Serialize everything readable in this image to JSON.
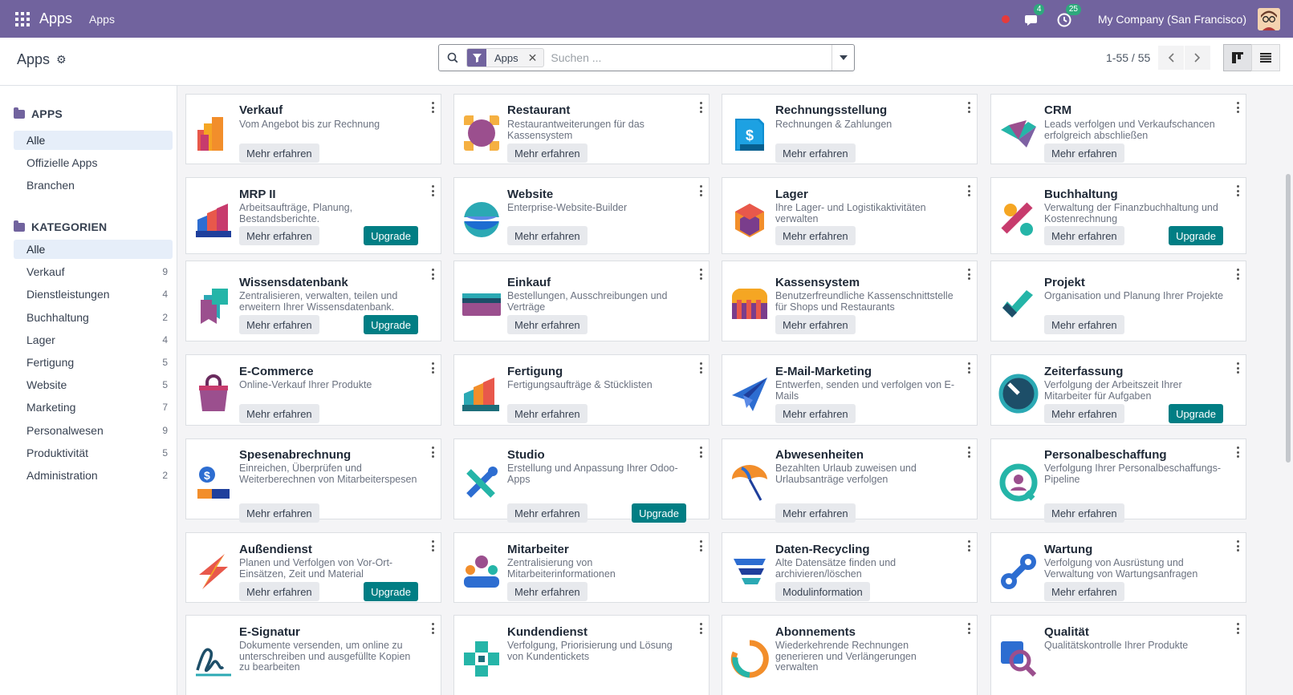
{
  "colors": {
    "navbar": "#71639e",
    "upgrade": "#017e84",
    "active_item": "#e6eef9"
  },
  "navbar": {
    "menu_icon": "apps-grid-icon",
    "title": "Apps",
    "menu_item": "Apps",
    "messages_badge": "4",
    "activity_badge": "25",
    "company": "My Company (San Francisco)"
  },
  "control": {
    "title": "Apps",
    "search": {
      "facet_label": "Apps",
      "placeholder": "Suchen ..."
    },
    "pager": "1-55 / 55"
  },
  "sidebar": {
    "apps_heading": "APPS",
    "apps_items": [
      {
        "label": "Alle",
        "active": true
      },
      {
        "label": "Offizielle Apps"
      },
      {
        "label": "Branchen"
      }
    ],
    "categories_heading": "KATEGORIEN",
    "category_items": [
      {
        "label": "Alle",
        "count": "",
        "active": true
      },
      {
        "label": "Verkauf",
        "count": "9"
      },
      {
        "label": "Dienstleistungen",
        "count": "4"
      },
      {
        "label": "Buchhaltung",
        "count": "2"
      },
      {
        "label": "Lager",
        "count": "4"
      },
      {
        "label": "Fertigung",
        "count": "5"
      },
      {
        "label": "Website",
        "count": "5"
      },
      {
        "label": "Marketing",
        "count": "7"
      },
      {
        "label": "Personalwesen",
        "count": "9"
      },
      {
        "label": "Produktivität",
        "count": "5"
      },
      {
        "label": "Administration",
        "count": "2"
      }
    ]
  },
  "apps": [
    {
      "name": "Verkauf",
      "desc": "Vom Angebot bis zur Rechnung",
      "button": "Mehr erfahren",
      "upgrade": "",
      "icon": "sales-icon"
    },
    {
      "name": "Restaurant",
      "desc": "Restaurantweiterungen für das Kassensystem",
      "button": "Mehr erfahren",
      "upgrade": "",
      "icon": "restaurant-icon"
    },
    {
      "name": "Rechnungsstellung",
      "desc": "Rechnungen & Zahlungen",
      "button": "Mehr erfahren",
      "upgrade": "",
      "icon": "invoicing-icon"
    },
    {
      "name": "CRM",
      "desc": "Leads verfolgen und Verkaufschancen erfolgreich abschließen",
      "button": "Mehr erfahren",
      "upgrade": "",
      "icon": "crm-icon"
    },
    {
      "name": "MRP II",
      "desc": "Arbeitsaufträge, Planung, Bestandsberichte.",
      "button": "Mehr erfahren",
      "upgrade": "Upgrade",
      "icon": "mrp-icon"
    },
    {
      "name": "Website",
      "desc": "Enterprise-Website-Builder",
      "button": "Mehr erfahren",
      "upgrade": "",
      "icon": "website-icon"
    },
    {
      "name": "Lager",
      "desc": "Ihre Lager- und Logistikaktivitäten verwalten",
      "button": "Mehr erfahren",
      "upgrade": "",
      "icon": "inventory-icon"
    },
    {
      "name": "Buchhaltung",
      "desc": "Verwaltung der Finanzbuchhaltung und Kostenrechnung",
      "button": "Mehr erfahren",
      "upgrade": "Upgrade",
      "icon": "accounting-icon"
    },
    {
      "name": "Wissensdatenbank",
      "desc": "Zentralisieren, verwalten, teilen und erweitern Ihrer Wissensdatenbank.",
      "button": "Mehr erfahren",
      "upgrade": "Upgrade",
      "icon": "knowledge-icon"
    },
    {
      "name": "Einkauf",
      "desc": "Bestellungen, Ausschreibungen und Verträge",
      "button": "Mehr erfahren",
      "upgrade": "",
      "icon": "purchase-icon"
    },
    {
      "name": "Kassensystem",
      "desc": "Benutzerfreundliche Kassenschnittstelle für Shops und Restaurants",
      "button": "Mehr erfahren",
      "upgrade": "",
      "icon": "pos-icon"
    },
    {
      "name": "Projekt",
      "desc": "Organisation und Planung Ihrer Projekte",
      "button": "Mehr erfahren",
      "upgrade": "",
      "icon": "project-icon"
    },
    {
      "name": "E-Commerce",
      "desc": "Online-Verkauf Ihrer Produkte",
      "button": "Mehr erfahren",
      "upgrade": "",
      "icon": "ecommerce-icon"
    },
    {
      "name": "Fertigung",
      "desc": "Fertigungsaufträge & Stücklisten",
      "button": "Mehr erfahren",
      "upgrade": "",
      "icon": "manufacturing-icon"
    },
    {
      "name": "E-Mail-Marketing",
      "desc": "Entwerfen, senden und verfolgen von E-Mails",
      "button": "Mehr erfahren",
      "upgrade": "",
      "icon": "email-marketing-icon"
    },
    {
      "name": "Zeiterfassung",
      "desc": "Verfolgung der Arbeitszeit Ihrer Mitarbeiter für Aufgaben",
      "button": "Mehr erfahren",
      "upgrade": "Upgrade",
      "icon": "timesheet-icon"
    },
    {
      "name": "Spesenabrechnung",
      "desc": "Einreichen, Überprüfen und Weiterberechnen von Mitarbeiterspesen",
      "button": "Mehr erfahren",
      "upgrade": "",
      "icon": "expenses-icon"
    },
    {
      "name": "Studio",
      "desc": "Erstellung und Anpassung Ihrer Odoo-Apps",
      "button": "Mehr erfahren",
      "upgrade": "Upgrade",
      "icon": "studio-icon"
    },
    {
      "name": "Abwesenheiten",
      "desc": "Bezahlten Urlaub zuweisen und Urlaubsanträge verfolgen",
      "button": "Mehr erfahren",
      "upgrade": "",
      "icon": "time-off-icon"
    },
    {
      "name": "Personalbeschaffung",
      "desc": "Verfolgung Ihrer Personalbeschaffungs-Pipeline",
      "button": "Mehr erfahren",
      "upgrade": "",
      "icon": "recruitment-icon"
    },
    {
      "name": "Außendienst",
      "desc": "Planen und Verfolgen von Vor-Ort-Einsätzen, Zeit und Material",
      "button": "Mehr erfahren",
      "upgrade": "Upgrade",
      "icon": "field-service-icon"
    },
    {
      "name": "Mitarbeiter",
      "desc": "Zentralisierung von Mitarbeiterinformationen",
      "button": "Mehr erfahren",
      "upgrade": "",
      "icon": "employees-icon"
    },
    {
      "name": "Daten-Recycling",
      "desc": "Alte Datensätze finden und archivieren/löschen",
      "button": "Modulinformation",
      "upgrade": "",
      "icon": "data-recycle-icon"
    },
    {
      "name": "Wartung",
      "desc": "Verfolgung von Ausrüstung und Verwaltung von Wartungsanfragen",
      "button": "Mehr erfahren",
      "upgrade": "",
      "icon": "maintenance-icon"
    },
    {
      "name": "E-Signatur",
      "desc": "Dokumente versenden, um online zu unterschreiben und ausgefüllte Kopien zu bearbeiten",
      "button": "",
      "upgrade": "",
      "icon": "sign-icon"
    },
    {
      "name": "Kundendienst",
      "desc": "Verfolgung, Priorisierung und Lösung von Kundentickets",
      "button": "",
      "upgrade": "",
      "icon": "helpdesk-icon"
    },
    {
      "name": "Abonnements",
      "desc": "Wiederkehrende Rechnungen generieren und Verlängerungen verwalten",
      "button": "",
      "upgrade": "",
      "icon": "subscriptions-icon"
    },
    {
      "name": "Qualität",
      "desc": "Qualitätskontrolle Ihrer Produkte",
      "button": "",
      "upgrade": "",
      "icon": "quality-icon"
    }
  ]
}
